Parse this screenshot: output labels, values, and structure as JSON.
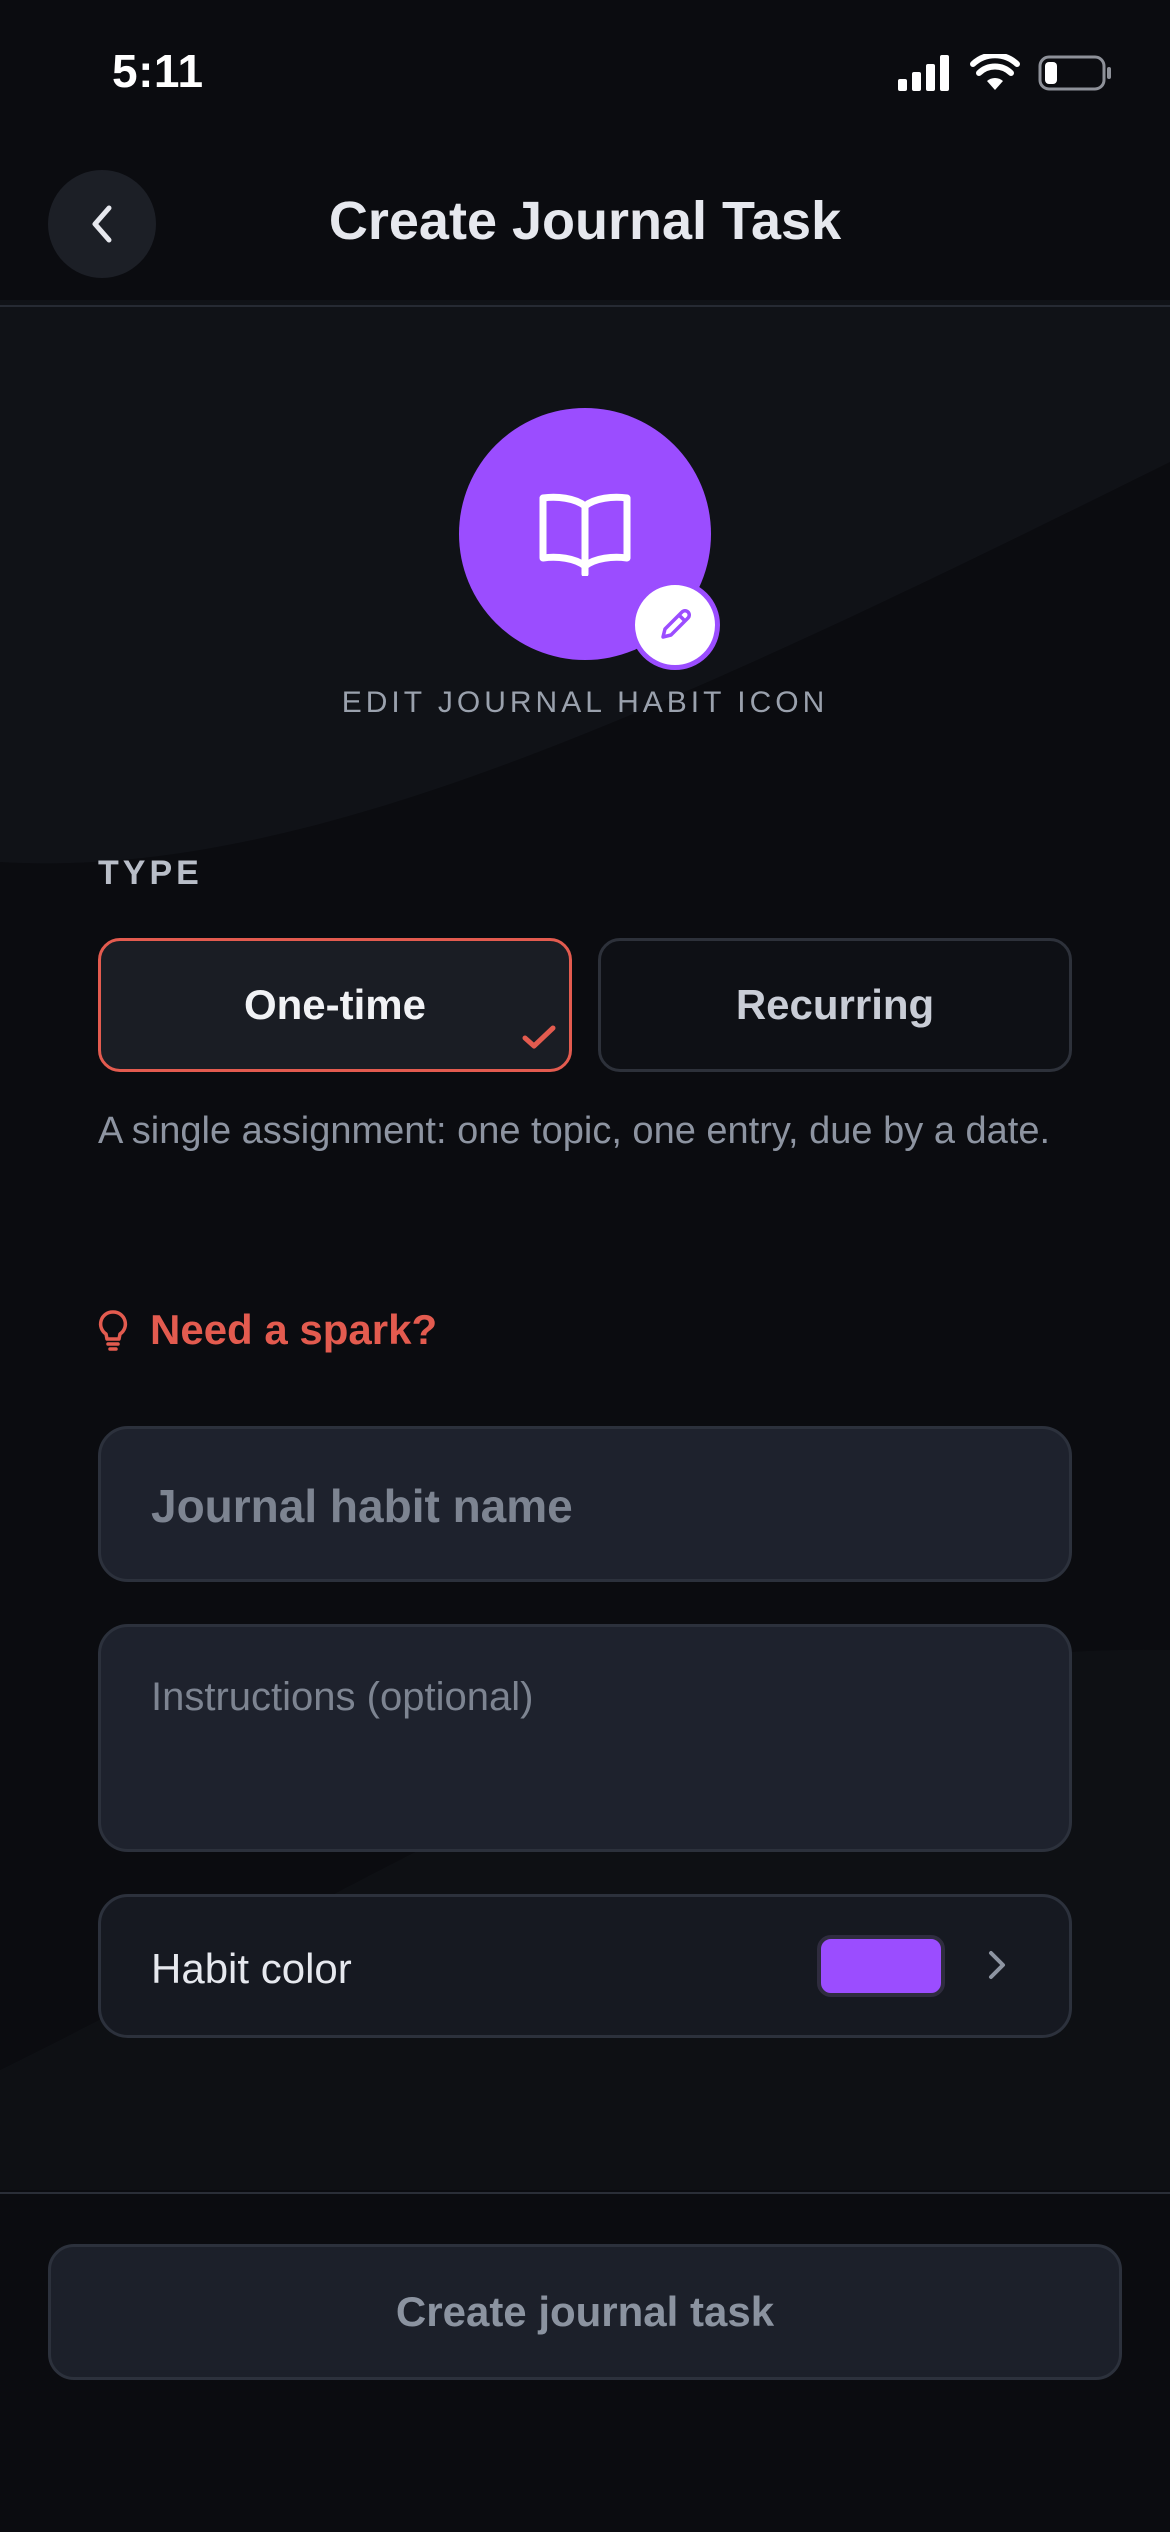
{
  "status_bar": {
    "time": "5:11"
  },
  "header": {
    "title": "Create Journal Task"
  },
  "habit_icon": {
    "icon": "book-icon",
    "edit_label": "EDIT JOURNAL HABIT ICON"
  },
  "type_section": {
    "label": "TYPE",
    "options": [
      {
        "label": "One-time",
        "selected": true
      },
      {
        "label": "Recurring",
        "selected": false
      }
    ],
    "description": "A single assignment: one topic, one entry, due by a date."
  },
  "spark": {
    "label": "Need a spark?"
  },
  "form": {
    "name_placeholder": "Journal habit name",
    "instructions_placeholder": "Instructions (optional)",
    "color_label": "Habit color",
    "color_value": "#9b4dff"
  },
  "footer": {
    "create_label": "Create journal task"
  },
  "colors": {
    "accent": "#9b4dff",
    "selection": "#e35b4f",
    "background": "#0b0c10"
  }
}
